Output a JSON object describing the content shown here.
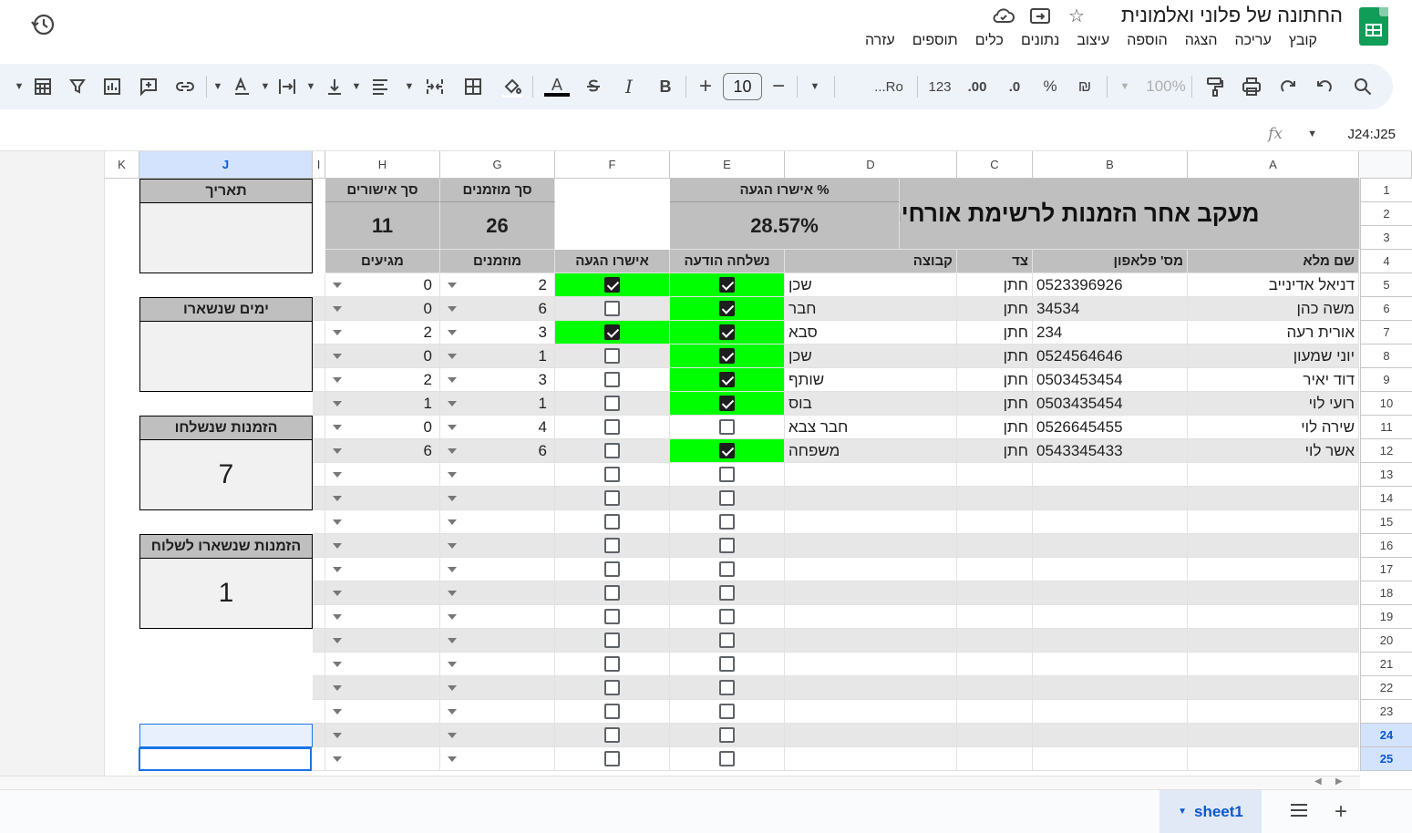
{
  "app": {
    "title": "החתונה של פלוני ואלמונית"
  },
  "menu": [
    "קובץ",
    "עריכה",
    "הצגה",
    "הוספה",
    "עיצוב",
    "נתונים",
    "כלים",
    "תוספים",
    "עזרה"
  ],
  "toolbar": {
    "zoom": "100%",
    "currency": "₪",
    "percent": "%",
    "dec_dec": ".0",
    "dec_inc": ".00",
    "format_more": "123",
    "font": "...Ro",
    "font_size": "10",
    "bold": "B",
    "italic": "I",
    "text_color": "A"
  },
  "formula_bar": {
    "name_box": "J24:J25",
    "fx": "fx"
  },
  "columns": [
    {
      "id": "A",
      "label": "A"
    },
    {
      "id": "B",
      "label": "B"
    },
    {
      "id": "C",
      "label": "C"
    },
    {
      "id": "D",
      "label": "D"
    },
    {
      "id": "E",
      "label": "E"
    },
    {
      "id": "F",
      "label": "F"
    },
    {
      "id": "G",
      "label": "G"
    },
    {
      "id": "H",
      "label": "H"
    },
    {
      "id": "I",
      "label": "I"
    },
    {
      "id": "J",
      "label": "J"
    },
    {
      "id": "K",
      "label": "K"
    }
  ],
  "rows": [
    "1",
    "2",
    "3",
    "4",
    "5",
    "6",
    "7",
    "8",
    "9",
    "10",
    "11",
    "12",
    "13",
    "14",
    "15",
    "16",
    "17",
    "18",
    "19",
    "20",
    "21",
    "22",
    "23",
    "24",
    "25"
  ],
  "sheet": {
    "title": "מעקב אחר הזמנות לרשימת אורחים",
    "stats": {
      "pct_label": "% אישרו הגעה",
      "pct_value": "28.57%",
      "invited_label": "סך מוזמנים",
      "invited_value": "26",
      "confirmed_label": "סך אישורים",
      "confirmed_value": "11"
    },
    "headers": {
      "name": "שם מלא",
      "phone": "מס' פלאפון",
      "side": "צד",
      "group": "קבוצה",
      "sent": "נשלחה הודעה",
      "confirmed": "אישרו הגעה",
      "invited": "מוזמנים",
      "arriving": "מגיעים"
    },
    "guests": [
      {
        "name": "דניאל אדינייב",
        "phone": "0523396926",
        "side": "חתן",
        "group": "שכן",
        "sent": true,
        "confirmed": true,
        "invited": "2",
        "arriving": "0"
      },
      {
        "name": "משה כהן",
        "phone": "34534",
        "side": "חתן",
        "group": "חבר",
        "sent": true,
        "confirmed": false,
        "invited": "6",
        "arriving": "0"
      },
      {
        "name": "אורית רעה",
        "phone": "234",
        "side": "חתן",
        "group": "סבא",
        "sent": true,
        "confirmed": true,
        "invited": "3",
        "arriving": "2"
      },
      {
        "name": "יוני שמעון",
        "phone": "0524564646",
        "side": "חתן",
        "group": "שכן",
        "sent": true,
        "confirmed": false,
        "invited": "1",
        "arriving": "0"
      },
      {
        "name": "דוד יאיר",
        "phone": "0503453454",
        "side": "חתן",
        "group": "שותף",
        "sent": true,
        "confirmed": false,
        "invited": "3",
        "arriving": "2"
      },
      {
        "name": "רועי לוי",
        "phone": "0503435454",
        "side": "חתן",
        "group": "בוס",
        "sent": true,
        "confirmed": false,
        "invited": "1",
        "arriving": "1"
      },
      {
        "name": "שירה לוי",
        "phone": "0526645455",
        "side": "חתן",
        "group": "חבר צבא",
        "sent": false,
        "confirmed": false,
        "invited": "4",
        "arriving": "0"
      },
      {
        "name": "אשר לוי",
        "phone": "0543345433",
        "side": "חתן",
        "group": "משפחה",
        "sent": true,
        "confirmed": false,
        "invited": "6",
        "arriving": "6"
      }
    ],
    "side_panel": [
      {
        "label": "תאריך",
        "value": ""
      },
      {
        "label": "ימים שנשארו",
        "value": ""
      },
      {
        "label": "הזמנות שנשלחו",
        "value": "7"
      },
      {
        "label": "הזמנות שנשארו לשלוח",
        "value": "1"
      }
    ]
  },
  "bottom": {
    "sheet_tab": "sheet1"
  }
}
